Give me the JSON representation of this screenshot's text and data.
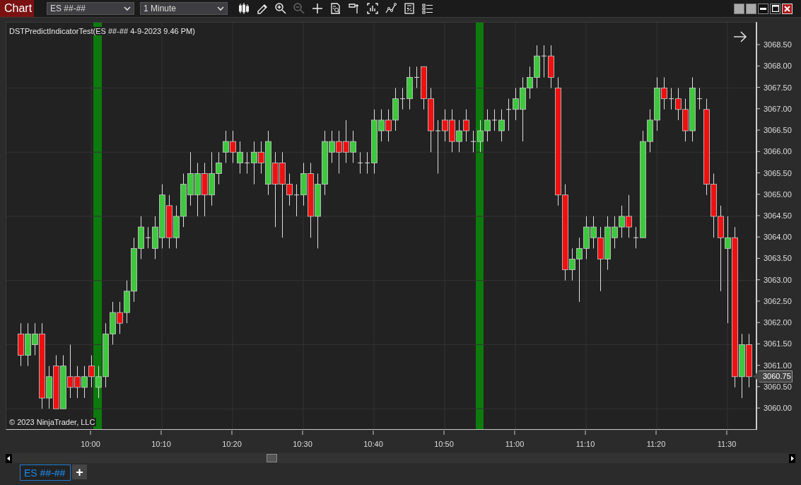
{
  "window": {
    "title": "Chart"
  },
  "toolbar": {
    "instrument": "ES ##-##",
    "interval": "1 Minute"
  },
  "chart": {
    "indicator_label": "DSTPredictIndicatorTest(ES ##-## 4-9-2023 9.46 PM)",
    "copyright": "© 2023 NinjaTrader, LLC",
    "current_price": "3060.75",
    "chart_data": {
      "type": "candlestick",
      "categories": [
        null,
        null,
        null,
        null,
        null,
        null,
        null,
        null,
        null,
        null,
        "10:00",
        null,
        null,
        null,
        null,
        null,
        null,
        null,
        null,
        null,
        "10:10",
        null,
        null,
        null,
        null,
        null,
        null,
        null,
        null,
        null,
        "10:20",
        null,
        null,
        null,
        null,
        null,
        null,
        null,
        null,
        null,
        "10:30",
        null,
        null,
        null,
        null,
        null,
        null,
        null,
        null,
        null,
        "10:40",
        null,
        null,
        null,
        null,
        null,
        null,
        null,
        null,
        null,
        "10:50",
        null,
        null,
        null,
        null,
        null,
        null,
        null,
        null,
        null,
        "11:00",
        null,
        null,
        null,
        null,
        null,
        null,
        null,
        null,
        null,
        "11:10",
        null,
        null,
        null,
        null,
        null,
        null,
        null,
        null,
        null,
        "11:20",
        null,
        null,
        null,
        null,
        null,
        null,
        null,
        null,
        null,
        "11:30",
        null,
        null,
        null
      ],
      "ylim": [
        3059.49,
        3069.03
      ],
      "ohlc": [
        [
          3061.75,
          3062,
          3061,
          3061.25
        ],
        [
          3061.25,
          3062,
          3061,
          3061.75
        ],
        [
          3061.5,
          3062,
          3061.25,
          3061.75
        ],
        [
          3061.75,
          3062,
          3060,
          3060.25
        ],
        [
          3060.25,
          3061,
          3060,
          3060.75
        ],
        [
          3061,
          3061.25,
          3060,
          3060
        ],
        [
          3060,
          3061.25,
          3060,
          3061
        ],
        [
          3060.75,
          3061.5,
          3060.25,
          3060.5
        ],
        [
          3060.75,
          3061,
          3060.25,
          3060.5
        ],
        [
          3060.5,
          3061,
          3060.25,
          3060.75
        ],
        [
          3061,
          3061.25,
          3060.5,
          3060.75
        ],
        [
          3060.5,
          3061,
          3060.25,
          3060.75
        ],
        [
          3060.75,
          3062,
          3060.5,
          3061.75
        ],
        [
          3061.75,
          3062.5,
          3061.5,
          3062.25
        ],
        [
          3062.25,
          3062.5,
          3061.75,
          3062
        ],
        [
          3062.25,
          3063,
          3062,
          3062.75
        ],
        [
          3062.75,
          3064,
          3062.5,
          3063.75
        ],
        [
          3063.75,
          3064.5,
          3063.5,
          3064.25
        ],
        [
          3064,
          3064.25,
          3063.75,
          3064
        ],
        [
          3063.75,
          3064.5,
          3063.5,
          3064.25
        ],
        [
          3064,
          3065.25,
          3063.75,
          3065
        ],
        [
          3064.75,
          3065,
          3063.75,
          3064
        ],
        [
          3064,
          3064.75,
          3063.75,
          3064.5
        ],
        [
          3064.5,
          3065.5,
          3064.25,
          3065.25
        ],
        [
          3065,
          3066,
          3064.75,
          3065.5
        ],
        [
          3065,
          3065.75,
          3064.5,
          3065.5
        ],
        [
          3065.5,
          3065.75,
          3064.5,
          3065
        ],
        [
          3065,
          3066,
          3064.75,
          3065.5
        ],
        [
          3065.5,
          3066,
          3065.25,
          3065.75
        ],
        [
          3066,
          3066.5,
          3065.75,
          3066.25
        ],
        [
          3066.25,
          3066.5,
          3065.75,
          3066
        ],
        [
          3065.75,
          3066.25,
          3065.5,
          3066
        ],
        [
          3065.75,
          3066,
          3065.5,
          3065.75
        ],
        [
          3065.75,
          3066.25,
          3065.25,
          3066
        ],
        [
          3066,
          3066.25,
          3065.5,
          3065.75
        ],
        [
          3065.25,
          3066.5,
          3065,
          3066.25
        ],
        [
          3065.75,
          3066,
          3064.25,
          3065.25
        ],
        [
          3065.75,
          3066,
          3064,
          3065.25
        ],
        [
          3065.25,
          3065.5,
          3064.75,
          3065
        ],
        [
          3065,
          3065.25,
          3064.5,
          3065
        ],
        [
          3065,
          3065.75,
          3064.75,
          3065.5
        ],
        [
          3065.5,
          3065.75,
          3064,
          3064.5
        ],
        [
          3064.5,
          3065.5,
          3063.75,
          3065.25
        ],
        [
          3065.25,
          3066.5,
          3065,
          3066.25
        ],
        [
          3066,
          3066.5,
          3065.75,
          3066.25
        ],
        [
          3066.25,
          3066.5,
          3065.5,
          3066
        ],
        [
          3066.25,
          3066.75,
          3065.75,
          3066
        ],
        [
          3066,
          3066.5,
          3065.75,
          3066.25
        ],
        [
          3065.75,
          3066,
          3065.5,
          3065.75
        ],
        [
          3065.75,
          3066,
          3065.5,
          3065.75
        ],
        [
          3065.75,
          3067,
          3065.5,
          3066.75
        ],
        [
          3066.5,
          3067,
          3066.25,
          3066.75
        ],
        [
          3066.75,
          3067,
          3066.25,
          3066.5
        ],
        [
          3066.75,
          3067.5,
          3066.5,
          3067.25
        ],
        [
          3067.25,
          3067.5,
          3067,
          3067.25
        ],
        [
          3067.25,
          3068,
          3067,
          3067.75
        ],
        [
          3067.75,
          3068,
          3067.5,
          3067.75
        ],
        [
          3068,
          3068,
          3067,
          3067.25
        ],
        [
          3067.25,
          3067.5,
          3066,
          3066.5
        ],
        [
          3066.5,
          3066.75,
          3065.5,
          3066.5
        ],
        [
          3066.75,
          3067,
          3066.25,
          3066.5
        ],
        [
          3066.75,
          3067,
          3066,
          3066.25
        ],
        [
          3066.25,
          3066.75,
          3066,
          3066.5
        ],
        [
          3066.75,
          3067,
          3066.25,
          3066.5
        ],
        [
          3066.25,
          3066.5,
          3066,
          3066.25
        ],
        [
          3066.25,
          3066.75,
          3066,
          3066.5
        ],
        [
          3066.5,
          3067,
          3066.25,
          3066.75
        ],
        [
          3066.75,
          3067,
          3066.5,
          3066.75
        ],
        [
          3066.5,
          3067,
          3066.25,
          3066.75
        ],
        [
          3067,
          3067.25,
          3066.5,
          3067
        ],
        [
          3067,
          3067.5,
          3066.75,
          3067.25
        ],
        [
          3067,
          3067.75,
          3066.25,
          3067.5
        ],
        [
          3067.5,
          3068,
          3067.25,
          3067.75
        ],
        [
          3067.75,
          3068.5,
          3067.5,
          3068.25
        ],
        [
          3068.25,
          3068.5,
          3067.75,
          3068.25
        ],
        [
          3068.25,
          3068.5,
          3067.5,
          3067.75
        ],
        [
          3067.5,
          3067.75,
          3064.75,
          3065
        ],
        [
          3065,
          3065.25,
          3063,
          3063.25
        ],
        [
          3063.25,
          3063.75,
          3063,
          3063.5
        ],
        [
          3063.5,
          3064,
          3062.5,
          3063.75
        ],
        [
          3063.75,
          3064.5,
          3063.5,
          3064.25
        ],
        [
          3064,
          3064.5,
          3063.75,
          3064.25
        ],
        [
          3064,
          3064.25,
          3062.75,
          3063.5
        ],
        [
          3063.5,
          3064.5,
          3063.25,
          3064.25
        ],
        [
          3064,
          3064.5,
          3063.75,
          3064.25
        ],
        [
          3064.25,
          3064.75,
          3064,
          3064.5
        ],
        [
          3064.5,
          3065,
          3064,
          3064.25
        ],
        [
          3064,
          3064.25,
          3063.75,
          3064
        ],
        [
          3064,
          3066.5,
          3064,
          3066.25
        ],
        [
          3066.25,
          3067,
          3066,
          3066.75
        ],
        [
          3066.75,
          3067.75,
          3066.5,
          3067.5
        ],
        [
          3067.5,
          3067.75,
          3067,
          3067.25
        ],
        [
          3067.25,
          3067.5,
          3067,
          3067.25
        ],
        [
          3067.25,
          3067.5,
          3066.75,
          3067
        ],
        [
          3067,
          3067.25,
          3066.25,
          3066.5
        ],
        [
          3066.5,
          3067.75,
          3066.25,
          3067.5
        ],
        [
          3067.25,
          3067.5,
          3067,
          3067.25
        ],
        [
          3067,
          3067.25,
          3065,
          3065.25
        ],
        [
          3065.25,
          3065.5,
          3064,
          3064.5
        ],
        [
          3064.5,
          3064.75,
          3062.75,
          3064
        ],
        [
          3063.75,
          3064.5,
          3062,
          3064
        ],
        [
          3064,
          3064.25,
          3060.5,
          3060.75
        ],
        [
          3060.75,
          3061.75,
          3060.25,
          3061.5
        ],
        [
          3061.5,
          3061.75,
          3060.5,
          3060.75
        ]
      ],
      "yticks": [
        {
          "value": 3068.5,
          "label": "3068.50"
        },
        {
          "value": 3068,
          "label": "3068.00"
        },
        {
          "value": 3067.5,
          "label": "3067.50"
        },
        {
          "value": 3067,
          "label": "3067.00"
        },
        {
          "value": 3066.5,
          "label": "3066.50"
        },
        {
          "value": 3066,
          "label": "3066.00"
        },
        {
          "value": 3065.5,
          "label": "3065.50"
        },
        {
          "value": 3065,
          "label": "3065.00"
        },
        {
          "value": 3064.5,
          "label": "3064.50"
        },
        {
          "value": 3064,
          "label": "3064.00"
        },
        {
          "value": 3063.5,
          "label": "3063.50"
        },
        {
          "value": 3063,
          "label": "3063.00"
        },
        {
          "value": 3062.5,
          "label": "3062.50"
        },
        {
          "value": 3062,
          "label": "3062.00"
        },
        {
          "value": 3061.5,
          "label": "3061.50"
        },
        {
          "value": 3061,
          "label": "3061.00"
        },
        {
          "value": 3060.5,
          "label": "3060.50"
        },
        {
          "value": 3060,
          "label": "3060.00"
        }
      ],
      "grid": true
    }
  },
  "tabs": [
    {
      "label": "ES ##-##",
      "selected": true
    }
  ],
  "add_tab": "+"
}
